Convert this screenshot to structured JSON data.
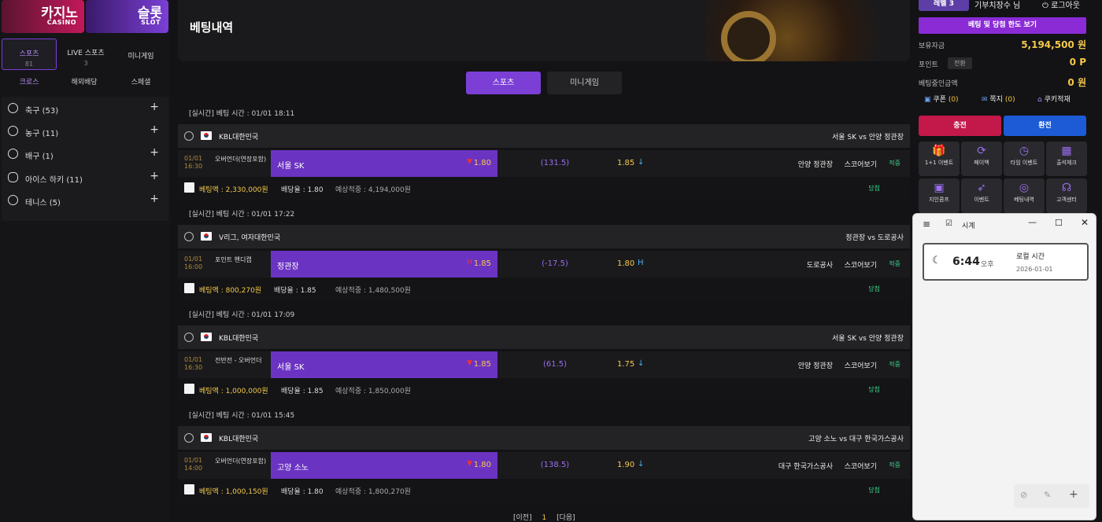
{
  "left": {
    "banners": [
      {
        "title": "카지노",
        "sub": "CASINO",
        "color": "#c2185b"
      },
      {
        "title": "슬롯",
        "sub": "SLOT",
        "color": "#7b3fd6"
      }
    ],
    "main_tabs": [
      {
        "label": "스포츠",
        "count": "81"
      },
      {
        "label": "LIVE 스포츠",
        "count": "3"
      },
      {
        "label": "미니게임",
        "count": ""
      }
    ],
    "sub_tabs": [
      "크로스",
      "해외배당",
      "스페셜"
    ],
    "sports": [
      {
        "label": "축구 (53)"
      },
      {
        "label": "농구 (11)"
      },
      {
        "label": "배구 (1)"
      },
      {
        "label": "아이스 하키 (11)"
      },
      {
        "label": "테니스 (5)"
      }
    ]
  },
  "center": {
    "title": "베팅내역",
    "tabs": [
      {
        "label": "스포츠"
      },
      {
        "label": "미니게임"
      }
    ],
    "bets": [
      {
        "time": "[실시간] 베팅 시간 : 01/01 18:11",
        "league": "KBL대한민국",
        "match": "서울 SK vs 안양 정관장",
        "date": "01/01",
        "hour": "16:30",
        "bet_type": "오버언더(연장포함)",
        "home": "서울 SK",
        "home_odd": "1.80",
        "home_arrow": "▼",
        "handicap": "(131.5)",
        "away_odd": "1.85",
        "away_arrow": "↓",
        "away": "안양 정관장",
        "score": "스코어보기",
        "status": "적중",
        "amount": "베팅액 : 2,330,000원",
        "rate": "배당율 : 1.80",
        "expected": "예상적중 : 4,194,000원",
        "result": "당첨"
      },
      {
        "time": "[실시간] 베팅 시간 : 01/01 17:22",
        "league": "V리그, 여자대한민국",
        "match": "정관장 vs 도로공사",
        "date": "01/01",
        "hour": "16:00",
        "bet_type": "포인트 핸디캡",
        "home": "정관장",
        "home_odd": "1.85",
        "home_arrow": "H",
        "handicap": "(-17.5)",
        "away_odd": "1.80",
        "away_arrow": "H",
        "away": "도로공사",
        "score": "스코어보기",
        "status": "적중",
        "amount": "베팅액 : 800,270원",
        "rate": "배당율 : 1.85",
        "expected": "예상적중 : 1,480,500원",
        "result": "당첨"
      },
      {
        "time": "[실시간] 베팅 시간 : 01/01 17:09",
        "league": "KBL대한민국",
        "match": "서울 SK vs 안양 정관장",
        "date": "01/01",
        "hour": "16:30",
        "bet_type": "전반전 - 오버언더",
        "home": "서울 SK",
        "home_odd": "1.85",
        "home_arrow": "▼",
        "handicap": "(61.5)",
        "away_odd": "1.75",
        "away_arrow": "↓",
        "away": "안양 정관장",
        "score": "스코어보기",
        "status": "적중",
        "amount": "베팅액 : 1,000,000원",
        "rate": "배당율 : 1.85",
        "expected": "예상적중 : 1,850,000원",
        "result": "당첨"
      },
      {
        "time": "[실시간] 베팅 시간 : 01/01 15:45",
        "league": "KBL대한민국",
        "match": "고양 소노 vs 대구 한국가스공사",
        "date": "01/01",
        "hour": "14:00",
        "bet_type": "오버언더(연장포함)",
        "home": "고양 소노",
        "home_odd": "1.80",
        "home_arrow": "▼",
        "handicap": "(138.5)",
        "away_odd": "1.90",
        "away_arrow": "↓",
        "away": "대구 한국가스공사",
        "score": "스코어보기",
        "status": "적중",
        "amount": "베팅액 : 1,000,150원",
        "rate": "배당율 : 1.80",
        "expected": "예상적중 : 1,800,270원",
        "result": "당첨"
      }
    ],
    "pager": {
      "prev": "[이전]",
      "page": "1",
      "next": "[다음]"
    }
  },
  "right": {
    "level": "레벨 3",
    "user": "기부치장수 님",
    "logout": "로그아웃",
    "limit_button": "베팅 및 당첨 한도 보기",
    "balance_label": "보유자금",
    "balance": "5,194,500 원",
    "point_label": "포인트",
    "convert": "전환",
    "point": "0 P",
    "betting_label": "베팅중인금액",
    "betting": "0 원",
    "coupon": "쿠폰",
    "coupon_count": "(0)",
    "memo": "쪽지",
    "memo_count": "(0)",
    "cookie": "쿠키적재",
    "deposit": "충전",
    "withdraw": "환전",
    "grid": [
      {
        "label": "1+1 이벤트",
        "icon": "🎁"
      },
      {
        "label": "페이백",
        "icon": "⟳"
      },
      {
        "label": "타임 이벤트",
        "icon": "◷"
      },
      {
        "label": "출석체크",
        "icon": "▦"
      },
      {
        "label": "지인콤프",
        "icon": "▣"
      },
      {
        "label": "이벤트",
        "icon": "➶"
      },
      {
        "label": "베팅내역",
        "icon": "◎"
      },
      {
        "label": "고객센터",
        "icon": "☊"
      }
    ]
  },
  "clock": {
    "title": "시계",
    "time": "6:44",
    "ampm": "오후",
    "label": "로컬 시간",
    "date": "2026-01-01"
  }
}
